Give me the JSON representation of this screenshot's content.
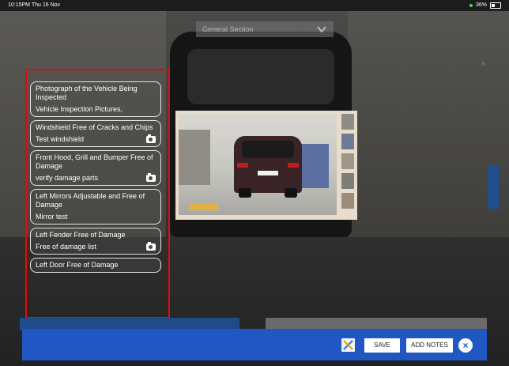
{
  "status_bar": {
    "time_date": "10:15PM Thu 16 Nov",
    "battery": "36%"
  },
  "section_dropdown": {
    "selected": "General Section"
  },
  "checklist": [
    {
      "title": "Photograph of the Vehicle Being Inspected",
      "subtitle": "Vehicle Inspection Pictures,",
      "camera": false
    },
    {
      "title": "Windshield Free of Cracks and Chips",
      "subtitle": "Test windshield",
      "camera": true
    },
    {
      "title": "Front Hood, Grill and Bumper Free of Damage",
      "subtitle": "verify damage parts",
      "camera": true
    },
    {
      "title": "Left Mirrors Adjustable and Free of Damage",
      "subtitle": "Mirror test",
      "camera": false
    },
    {
      "title": "Left Fender Free of Damage",
      "subtitle": "Free of damage list",
      "camera": true
    },
    {
      "title": "Left Door Free of Damage",
      "subtitle": "",
      "camera": false
    }
  ],
  "action_bar": {
    "save_label": "SAVE",
    "add_notes_label": "ADD NOTES",
    "close_symbol": "×"
  },
  "icons": {
    "tools": "tools-icon",
    "camera": "camera-icon",
    "chevron": "chevron-down-icon",
    "close": "close-icon"
  },
  "colors": {
    "highlight_border": "#e20b0b",
    "action_bar": "#2157c3"
  }
}
